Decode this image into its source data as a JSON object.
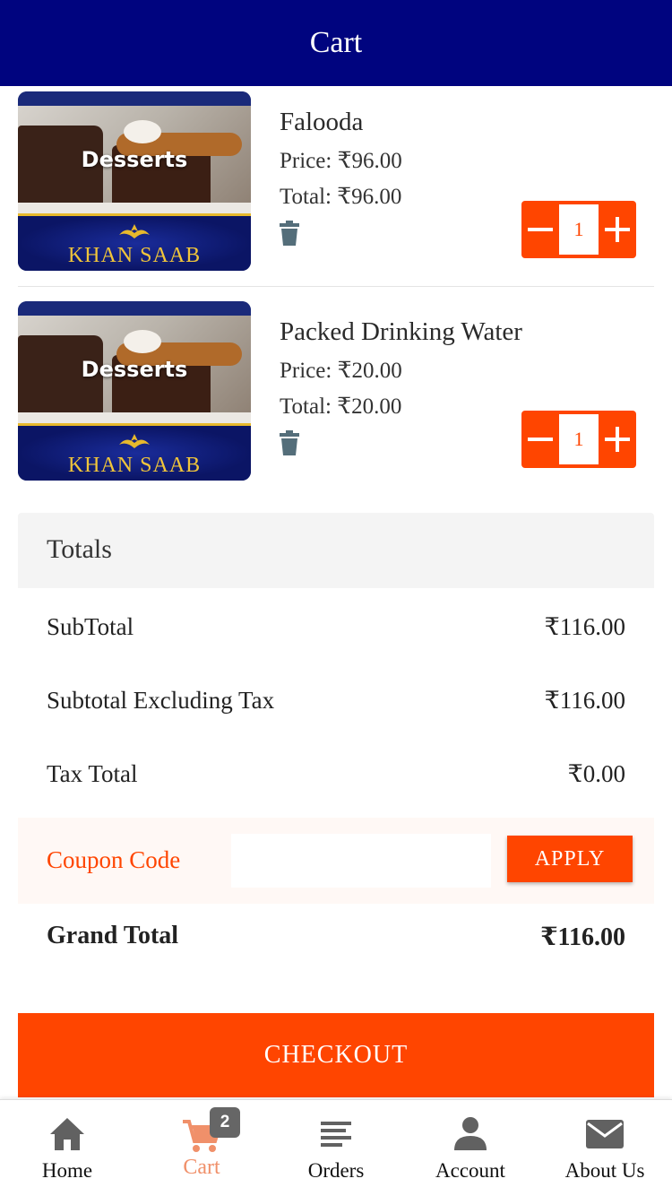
{
  "header": {
    "title": "Cart"
  },
  "items": [
    {
      "image_label": "Desserts",
      "image_brand": "KHAN SAAB",
      "name": "Falooda",
      "price": "Price: ₹96.00",
      "total": "Total: ₹96.00",
      "quantity": "1"
    },
    {
      "image_label": "Desserts",
      "image_brand": "KHAN SAAB",
      "name": "Packed Drinking Water",
      "price": "Price: ₹20.00",
      "total": "Total: ₹20.00",
      "quantity": "1"
    }
  ],
  "totals": {
    "heading": "Totals",
    "subtotal_label": "SubTotal",
    "subtotal_value": "₹116.00",
    "subtotal_ex_tax_label": "Subtotal Excluding Tax",
    "subtotal_ex_tax_value": "₹116.00",
    "tax_label": "Tax Total",
    "tax_value": "₹0.00",
    "coupon_label": "Coupon Code",
    "coupon_value": "",
    "coupon_placeholder": "",
    "apply_label": "APPLY",
    "grand_label": "Grand Total",
    "grand_value": "₹116.00"
  },
  "checkout_label": "CHECKOUT",
  "tabbar": {
    "home": "Home",
    "cart": "Cart",
    "cart_badge": "2",
    "orders": "Orders",
    "account": "Account",
    "about": "About Us"
  },
  "colors": {
    "header_bg": "#00047f",
    "accent": "#ff4500",
    "active_tab": "#f0906a"
  },
  "icons": [
    "trash-icon",
    "minus-icon",
    "plus-icon",
    "home-icon",
    "cart-icon",
    "orders-icon",
    "account-icon",
    "mail-icon"
  ]
}
